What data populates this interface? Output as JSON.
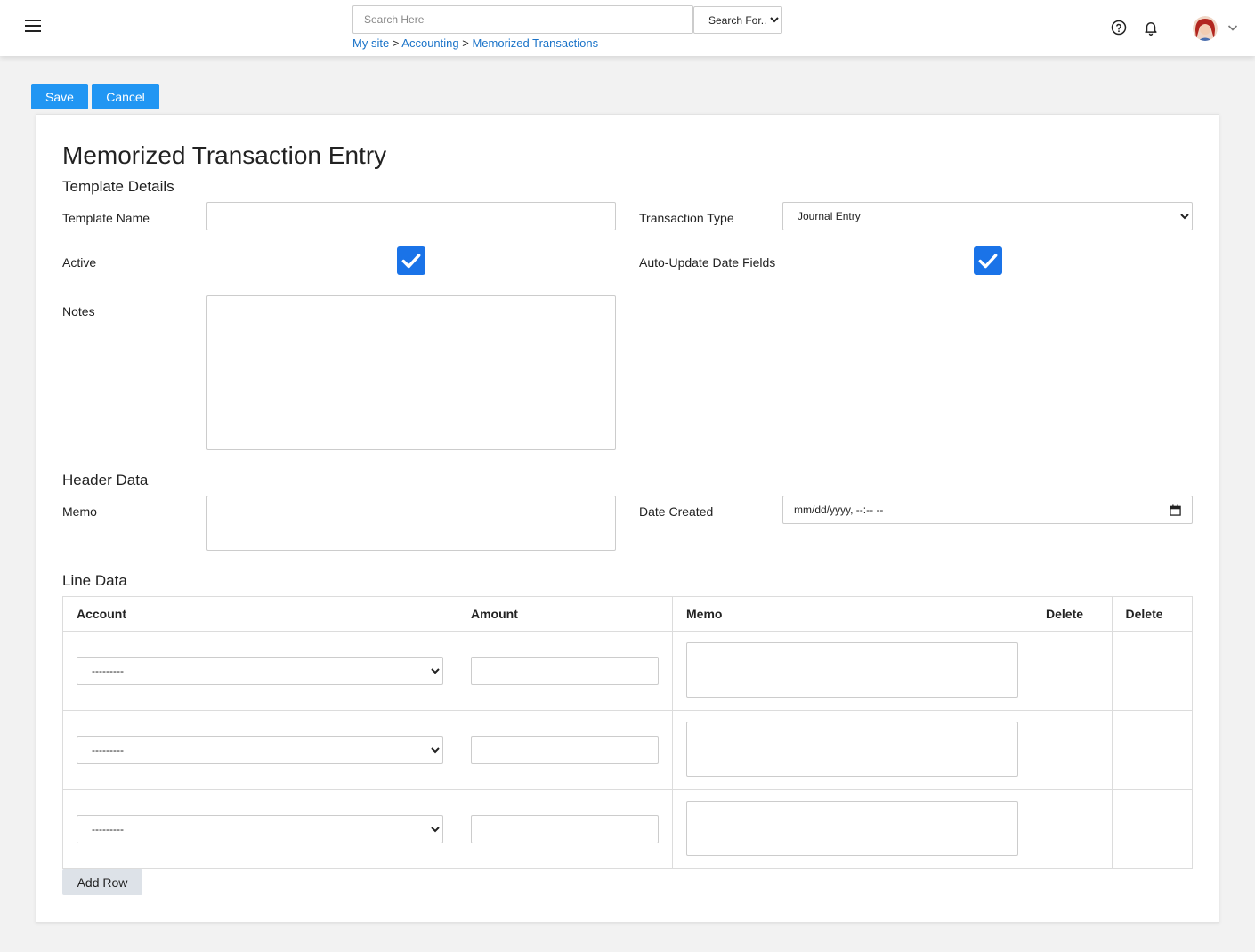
{
  "header": {
    "search": {
      "placeholder": "Search Here",
      "scope_selected": "Search For..."
    },
    "breadcrumb": [
      {
        "label": "My site"
      },
      {
        "label": "Accounting"
      },
      {
        "label": "Memorized Transactions"
      }
    ],
    "breadcrumb_separator": ">"
  },
  "toolbar": {
    "save_label": "Save",
    "cancel_label": "Cancel"
  },
  "form": {
    "title": "Memorized Transaction Entry",
    "sections": {
      "template_details": "Template Details",
      "header_data": "Header Data",
      "line_data": "Line Data"
    },
    "template_name": {
      "label": "Template Name",
      "value": ""
    },
    "transaction_type": {
      "label": "Transaction Type",
      "selected": "Journal Entry"
    },
    "active": {
      "label": "Active",
      "checked": true
    },
    "auto_update": {
      "label": "Auto-Update Date Fields",
      "checked": true
    },
    "notes": {
      "label": "Notes",
      "value": ""
    },
    "memo": {
      "label": "Memo",
      "value": ""
    },
    "date_created": {
      "label": "Date Created",
      "placeholder": "mm/dd/yyyy, --:-- --"
    }
  },
  "line_table": {
    "columns": [
      "Account",
      "Amount",
      "Memo",
      "Delete",
      "Delete"
    ],
    "rows": [
      {
        "account": "---------",
        "amount": "",
        "memo": ""
      },
      {
        "account": "---------",
        "amount": "",
        "memo": ""
      },
      {
        "account": "---------",
        "amount": "",
        "memo": ""
      }
    ],
    "add_row_label": "Add Row"
  },
  "colors": {
    "primary": "#2196f3",
    "checkbox": "#1a73e8",
    "link": "#1a73c8",
    "secondary_button": "#dde2e8"
  }
}
